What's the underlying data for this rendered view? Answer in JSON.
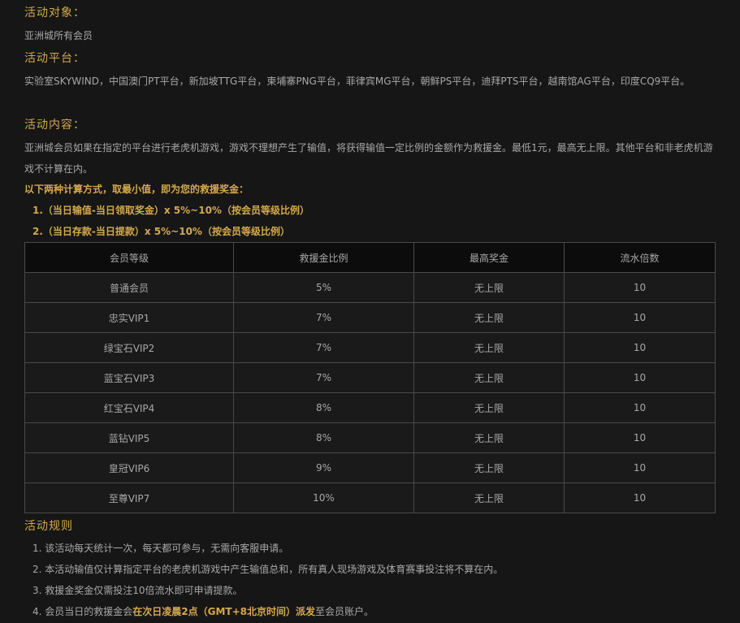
{
  "target": {
    "heading": "活动对象：",
    "text": "亚洲城所有会员"
  },
  "platform": {
    "heading": "活动平台：",
    "text": "实验室SKYWIND，中国澳门PT平台，新加坡TTG平台，柬埔寨PNG平台，菲律宾MG平台，朝鲜PS平台，迪拜PTS平台，越南馆AG平台，印度CQ9平台。"
  },
  "content": {
    "heading": "活动内容：",
    "text": "亚洲城会员如果在指定的平台进行老虎机游戏，游戏不理想产生了输值，将获得输值一定比例的金额作为救援金。最低1元，最高无上限。其他平台和非老虎机游戏不计算在内。"
  },
  "calc": {
    "intro": "以下两种计算方式，取最小值，即为您的救援奖金：",
    "formula1": "1.（当日输值-当日领取奖金）x 5%~10%（按会员等级比例）",
    "formula2": "2.（当日存款-当日提款）x 5%~10%（按会员等级比例）"
  },
  "table": {
    "headers": [
      "会员等级",
      "救援金比例",
      "最高奖金",
      "流水倍数"
    ],
    "rows": [
      [
        "普通会员",
        "5%",
        "无上限",
        "10"
      ],
      [
        "忠实VIP1",
        "7%",
        "无上限",
        "10"
      ],
      [
        "绿宝石VIP2",
        "7%",
        "无上限",
        "10"
      ],
      [
        "蓝宝石VIP3",
        "7%",
        "无上限",
        "10"
      ],
      [
        "红宝石VIP4",
        "8%",
        "无上限",
        "10"
      ],
      [
        "蓝钻VIP5",
        "8%",
        "无上限",
        "10"
      ],
      [
        "皇冠VIP6",
        "9%",
        "无上限",
        "10"
      ],
      [
        "至尊VIP7",
        "10%",
        "无上限",
        "10"
      ]
    ]
  },
  "rules": {
    "heading": "活动规则",
    "items": [
      "1. 该活动每天统计一次，每天都可参与，无需向客服申请。",
      "2. 本活动输值仅计算指定平台的老虎机游戏中产生输值总和，所有真人现场游戏及体育赛事投注将不算在内。",
      "3. 救援金奖金仅需投注10倍流水即可申请提款。"
    ],
    "item4": {
      "pre": "4. 会员当日的救援金会",
      "highlight": "在次日凌晨2点（GMT+8北京时间）派发",
      "post": "至会员账户。"
    }
  },
  "colors": {
    "background": "#161616",
    "accent_gold": "#d4a94c",
    "text_gray": "#a8a8a8",
    "border": "#4a4a4a"
  }
}
